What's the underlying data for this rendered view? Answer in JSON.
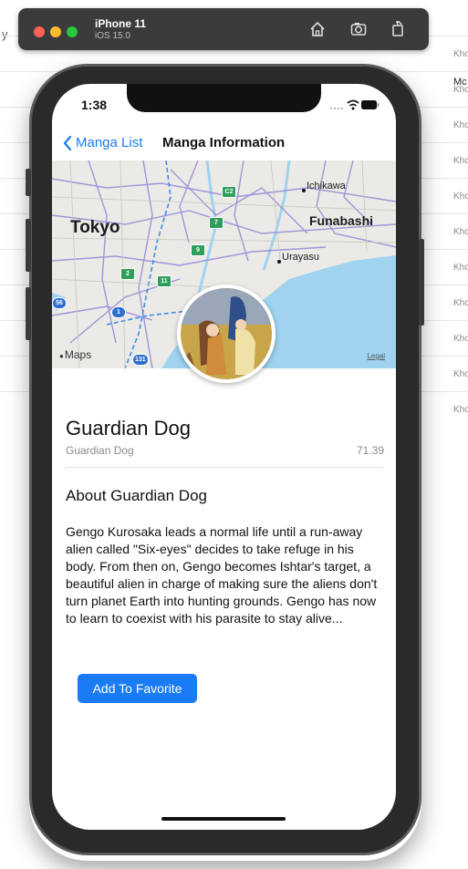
{
  "background": {
    "left_fragment": "y",
    "column_header": "Mc",
    "rows": [
      "Khc",
      "Khc",
      "Khc",
      "Khc",
      "Khc",
      "Khc",
      "Khc",
      "Khc",
      "Khc",
      "Khc",
      "Khc"
    ]
  },
  "simulator": {
    "device": "iPhone 11",
    "os": "iOS 15.0",
    "icons": [
      "home-icon",
      "screenshot-icon",
      "rotate-icon"
    ]
  },
  "status_bar": {
    "time": "1:38"
  },
  "nav": {
    "back_label": "Manga List",
    "title": "Manga Information"
  },
  "map": {
    "city_labels": [
      "Tokyo",
      "Ichikawa",
      "Funabashi",
      "Urayasu"
    ],
    "route_badges": [
      "C2",
      "7",
      "9",
      "2",
      "11",
      "1",
      "56",
      "131"
    ],
    "brand": "Maps",
    "legal": "Legal"
  },
  "manga": {
    "title": "Guardian Dog",
    "subtitle": "Guardian Dog",
    "score": "71.39",
    "about_heading": "About Guardian Dog",
    "description": "Gengo Kurosaka leads a normal life until a run-away alien called \"Six-eyes\" decides to take refuge in his body. From then on, Gengo becomes Ishtar's target, a beautiful alien in charge of making sure the aliens don't turn planet Earth into hunting grounds. Gengo has now to learn to coexist with his parasite to stay alive...",
    "favorite_button": "Add To Favorite"
  },
  "colors": {
    "accent": "#1a7cf5",
    "water": "#9fd3f0",
    "highway_badge": "#2e9e5b"
  }
}
